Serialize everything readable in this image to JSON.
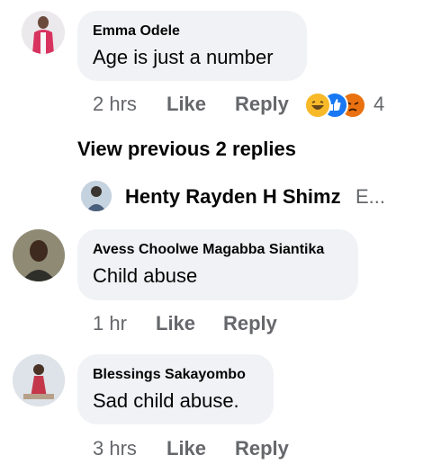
{
  "comments": [
    {
      "author": "Emma Odele",
      "text": "Age is just a number",
      "time": "2 hrs",
      "like_label": "Like",
      "reply_label": "Reply",
      "reaction_count": "4",
      "reactions": [
        "haha-icon",
        "like-icon",
        "angry-icon"
      ]
    },
    {
      "author": "Avess Choolwe Magabba Siantika",
      "text": "Child abuse",
      "time": "1 hr",
      "like_label": "Like",
      "reply_label": "Reply"
    },
    {
      "author": "Blessings Sakayombo",
      "text": "Sad child abuse.",
      "time": "3 hrs",
      "like_label": "Like",
      "reply_label": "Reply"
    }
  ],
  "view_previous": "View previous 2 replies",
  "reply_preview": {
    "author": "Henty Rayden H Shimz",
    "snippet": "E..."
  }
}
